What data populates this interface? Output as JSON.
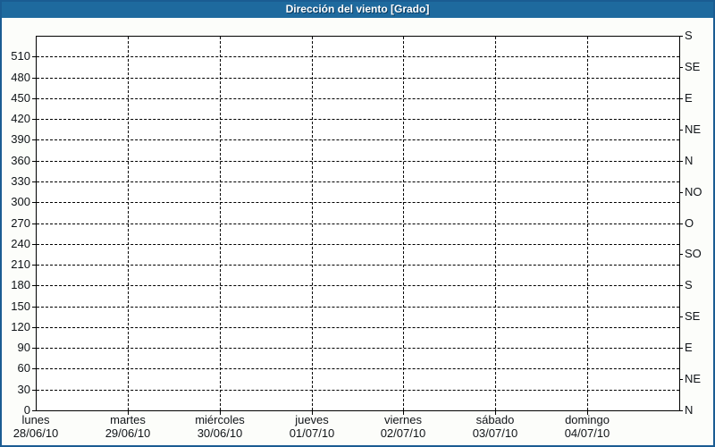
{
  "window": {
    "title": "Dirección del viento [Grado]"
  },
  "colors": {
    "titlebar_bg": "#1e6a9e",
    "titlebar_text": "#ffffff",
    "title_shadow": "#0b3a5e",
    "frame_border": "#1a5c92",
    "plot_border": "#000000",
    "grid": "#000000",
    "label_text": "#101418",
    "background": "#fcfdfa",
    "plot_background": "#ffffff"
  },
  "chart_data": {
    "type": "line",
    "title": "Dirección del viento [Grado]",
    "y_axis_unit": "Grado",
    "y_range": [
      0,
      540
    ],
    "y_tick_step": 30,
    "grid_style": "dashed",
    "legend": "none",
    "series": [],
    "y_left_ticks": [
      0,
      30,
      60,
      90,
      120,
      150,
      180,
      210,
      240,
      270,
      300,
      330,
      360,
      390,
      420,
      450,
      480,
      510
    ],
    "y_right_compass_ticks": [
      {
        "deg": 540,
        "label": "S"
      },
      {
        "deg": 495,
        "label": "SE"
      },
      {
        "deg": 450,
        "label": "E"
      },
      {
        "deg": 405,
        "label": "NE"
      },
      {
        "deg": 360,
        "label": "N"
      },
      {
        "deg": 315,
        "label": "NO"
      },
      {
        "deg": 270,
        "label": "O"
      },
      {
        "deg": 225,
        "label": "SO"
      },
      {
        "deg": 180,
        "label": "S"
      },
      {
        "deg": 135,
        "label": "SE"
      },
      {
        "deg": 90,
        "label": "E"
      },
      {
        "deg": 45,
        "label": "NE"
      },
      {
        "deg": 0,
        "label": "N"
      }
    ],
    "x_days": [
      {
        "name": "lunes",
        "date": "28/06/10"
      },
      {
        "name": "martes",
        "date": "29/06/10"
      },
      {
        "name": "miércoles",
        "date": "30/06/10"
      },
      {
        "name": "jueves",
        "date": "01/07/10"
      },
      {
        "name": "viernes",
        "date": "02/07/10"
      },
      {
        "name": "sábado",
        "date": "03/07/10"
      },
      {
        "name": "domingo",
        "date": "04/07/10"
      }
    ]
  }
}
